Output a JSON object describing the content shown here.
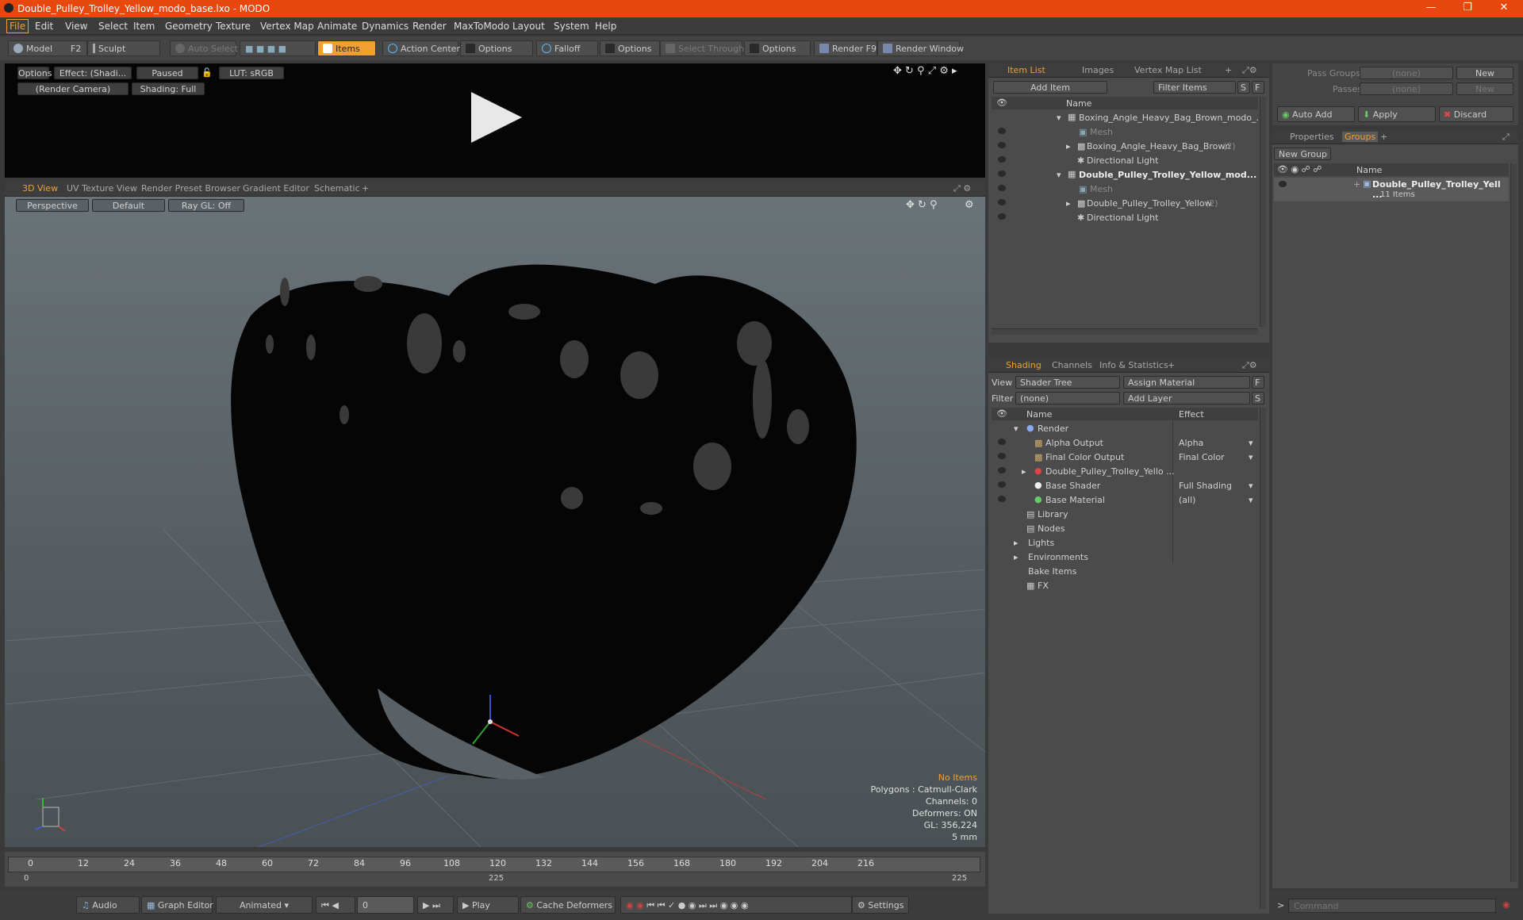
{
  "window": {
    "title": "Double_Pulley_Trolley_Yellow_modo_base.lxo - MODO"
  },
  "menu": [
    "File",
    "Edit",
    "View",
    "Select",
    "Item",
    "Geometry",
    "Texture",
    "Vertex Map",
    "Animate",
    "Dynamics",
    "Render",
    "MaxToModo",
    "Layout",
    "System",
    "Help"
  ],
  "toolbar": {
    "model": "Model",
    "model_key": "F2",
    "sculpt": "Sculpt",
    "auto_select": "Auto Select",
    "items": "Items",
    "action_center": "Action Center",
    "options1": "Options",
    "falloff": "Falloff",
    "options2": "Options",
    "select_through": "Select Through",
    "options3": "Options",
    "render": "Render",
    "render_key": "F9",
    "render_window": "Render Window"
  },
  "preview": {
    "options": "Options",
    "effect": "Effect: (Shadi...",
    "paused": "Paused",
    "lut": "LUT: sRGB",
    "camera": "(Render Camera)",
    "shading": "Shading: Full"
  },
  "viewport_tabs": [
    "3D View",
    "UV Texture View",
    "Render Preset Browser",
    "Gradient Editor",
    "Schematic"
  ],
  "viewport": {
    "perspective": "Perspective",
    "default": "Default",
    "raygl": "Ray GL: Off",
    "info": {
      "no_items": "No Items",
      "polygons": "Polygons : Catmull-Clark",
      "channels": "Channels: 0",
      "deformers": "Deformers: ON",
      "gl": "GL: 356,224",
      "units": "5 mm"
    },
    "model_fill": "#050505"
  },
  "timeline": {
    "ticks": [
      "0",
      "12",
      "24",
      "36",
      "48",
      "60",
      "72",
      "84",
      "96",
      "108",
      "120",
      "132",
      "144",
      "156",
      "168",
      "180",
      "192",
      "204",
      "216"
    ],
    "start": "0",
    "mid": "225",
    "end": "225"
  },
  "bottombar": {
    "audio": "Audio",
    "graph_editor": "Graph Editor",
    "animated": "Animated",
    "frame": "0",
    "play": "Play",
    "cache_deformers": "Cache Deformers",
    "settings": "Settings"
  },
  "itemlist": {
    "tabs": [
      "Item List",
      "Images",
      "Vertex Map List"
    ],
    "add_item": "Add Item",
    "filter_items": "Filter Items",
    "s_btn": "S",
    "f_btn": "F",
    "col_name": "Name",
    "rows": [
      {
        "label": "Boxing_Angle_Heavy_Bag_Brown_modo_...",
        "count": ""
      },
      {
        "label": "Mesh",
        "count": ""
      },
      {
        "label": "Boxing_Angle_Heavy_Bag_Brown",
        "count": "(2)"
      },
      {
        "label": "Directional Light",
        "count": ""
      },
      {
        "label": "Double_Pulley_Trolley_Yellow_mod...",
        "count": ""
      },
      {
        "label": "Mesh",
        "count": ""
      },
      {
        "label": "Double_Pulley_Trolley_Yellow",
        "count": "(2)"
      },
      {
        "label": "Directional Light",
        "count": ""
      }
    ]
  },
  "shading": {
    "tabs": [
      "Shading",
      "Channels",
      "Info & Statistics"
    ],
    "view_label": "View",
    "view_value": "Shader Tree",
    "assign_material": "Assign Material",
    "filter_label": "Filter",
    "filter_value": "(none)",
    "add_layer": "Add Layer",
    "f_btn": "F",
    "s_btn": "S",
    "col_name": "Name",
    "col_effect": "Effect",
    "rows": [
      {
        "label": "Render",
        "effect": ""
      },
      {
        "label": "Alpha Output",
        "effect": "Alpha"
      },
      {
        "label": "Final Color Output",
        "effect": "Final Color"
      },
      {
        "label": "Double_Pulley_Trolley_Yello ...",
        "effect": ""
      },
      {
        "label": "Base Shader",
        "effect": "Full Shading"
      },
      {
        "label": "Base Material",
        "effect": "(all)"
      },
      {
        "label": "Library",
        "effect": ""
      },
      {
        "label": "Nodes",
        "effect": ""
      },
      {
        "label": "Lights",
        "effect": ""
      },
      {
        "label": "Environments",
        "effect": ""
      },
      {
        "label": "Bake Items",
        "effect": ""
      },
      {
        "label": "FX",
        "effect": ""
      }
    ]
  },
  "passes": {
    "pass_groups": "Pass Groups",
    "pass_groups_value": "(none)",
    "new1": "New",
    "passes": "Passes",
    "passes_value": "(none)",
    "new2": "New",
    "auto_add": "Auto Add",
    "apply": "Apply",
    "discard": "Discard"
  },
  "groups": {
    "tabs": [
      "Properties",
      "Groups"
    ],
    "new_group": "New Group",
    "col_name": "Name",
    "group_name": "Double_Pulley_Trolley_Yell ...",
    "group_count": "11 Items"
  },
  "command": {
    "placeholder": "Command"
  },
  "colors": {
    "accent": "#f0a030",
    "titlebar": "#e8470e"
  }
}
